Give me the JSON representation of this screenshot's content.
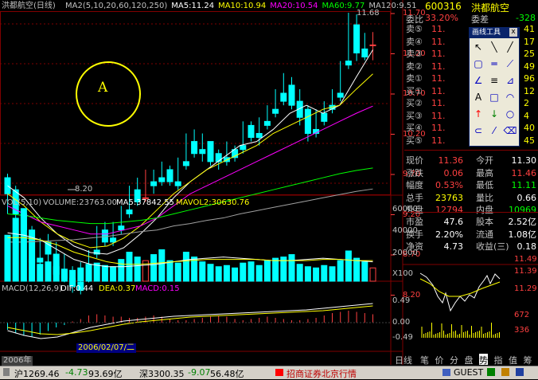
{
  "header": {
    "name": "洪都航空(日线)",
    "ma_items": [
      {
        "text": "MA2(5,10,20,60,120,250)",
        "color": "#c0c0c0"
      },
      {
        "text": "MA5:11.24",
        "color": "#ffffff"
      },
      {
        "text": "MA10:10.94",
        "color": "#ffff00"
      },
      {
        "text": "MA20:10.54",
        "color": "#ff00ff"
      },
      {
        "text": "MA60:9.77",
        "color": "#00ff00"
      },
      {
        "text": "MA120:9.51",
        "color": "#c0c0c0"
      }
    ]
  },
  "price_axis": [
    "11.70",
    "11.20",
    "10.70",
    "10.20",
    "9.70",
    "9.20",
    "8.70",
    "8.20"
  ],
  "price_marks": {
    "high": "11.68",
    "low": "8.20"
  },
  "annotation": "A",
  "vol": {
    "title": "VOL(5,10)",
    "volume": "VOLUME:23763.00",
    "ma5": "MA5:37842.55",
    "mavol2": "MAVOL2:30630.76",
    "axis": [
      "60000",
      "40000",
      "20000",
      "X100"
    ]
  },
  "macd": {
    "title": "MACD(12,26,9)",
    "dif": "DIF:0.44",
    "dea": "DEA:0.37",
    "macd": "MACD:0.15",
    "axis": [
      "0.49",
      "0.00",
      "-0.49"
    ],
    "date": "2006/02/07/二"
  },
  "bottom_left_year": "2006年",
  "quote": {
    "code": "600316",
    "name": "洪都航空",
    "webi_label": "委比",
    "webi": "33.20%",
    "weicha_label": "委差",
    "weicha": "-328",
    "asks": [
      {
        "l": "卖⑤",
        "p": "11.",
        "v": "41"
      },
      {
        "l": "卖④",
        "p": "11.",
        "v": "17"
      },
      {
        "l": "卖③",
        "p": "11.",
        "v": "25"
      },
      {
        "l": "卖②",
        "p": "11.",
        "v": "49"
      },
      {
        "l": "卖①",
        "p": "11.",
        "v": "96"
      }
    ],
    "bids": [
      {
        "l": "买①",
        "p": "11.",
        "v": "12"
      },
      {
        "l": "买②",
        "p": "11.",
        "v": "2"
      },
      {
        "l": "买③",
        "p": "11.",
        "v": "4"
      },
      {
        "l": "买④",
        "p": "11.",
        "v": "40"
      },
      {
        "l": "买⑤",
        "p": "11.",
        "v": "45"
      }
    ],
    "rows": [
      [
        {
          "t": "现价",
          "c": "#c0c0c0"
        },
        {
          "t": "11.36",
          "c": "#ff4040"
        },
        {
          "t": "今开",
          "c": "#c0c0c0"
        },
        {
          "t": "11.30",
          "c": "#ffffff"
        }
      ],
      [
        {
          "t": "涨跌",
          "c": "#c0c0c0"
        },
        {
          "t": "0.06",
          "c": "#ff4040"
        },
        {
          "t": "最高",
          "c": "#c0c0c0"
        },
        {
          "t": "11.46",
          "c": "#ff4040"
        }
      ],
      [
        {
          "t": "幅度",
          "c": "#c0c0c0"
        },
        {
          "t": "0.53%",
          "c": "#ff4040"
        },
        {
          "t": "最低",
          "c": "#c0c0c0"
        },
        {
          "t": "11.11",
          "c": "#00ff00"
        }
      ],
      [
        {
          "t": "总手",
          "c": "#c0c0c0"
        },
        {
          "t": "23763",
          "c": "#ffff00"
        },
        {
          "t": "量比",
          "c": "#c0c0c0"
        },
        {
          "t": "0.66",
          "c": "#ffffff"
        }
      ],
      [
        {
          "t": "外盘",
          "c": "#c0c0c0"
        },
        {
          "t": "12794",
          "c": "#ff4040"
        },
        {
          "t": "内盘",
          "c": "#c0c0c0"
        },
        {
          "t": "10969",
          "c": "#00ff00"
        }
      ],
      [
        {
          "t": "市盈",
          "c": "#c0c0c0"
        },
        {
          "t": "47.6",
          "c": "#ffffff"
        },
        {
          "t": "股本",
          "c": "#c0c0c0"
        },
        {
          "t": "2.52亿",
          "c": "#ffffff"
        }
      ],
      [
        {
          "t": "换手",
          "c": "#c0c0c0"
        },
        {
          "t": "2.20%",
          "c": "#ffffff"
        },
        {
          "t": "流通",
          "c": "#c0c0c0"
        },
        {
          "t": "1.08亿",
          "c": "#ffffff"
        }
      ],
      [
        {
          "t": "净资",
          "c": "#c0c0c0"
        },
        {
          "t": "4.73",
          "c": "#ffffff"
        },
        {
          "t": "收益(三)",
          "c": "#c0c0c0"
        },
        {
          "t": "0.18",
          "c": "#ffffff"
        }
      ]
    ],
    "mini_axis": [
      "11.49",
      "11.39",
      "11.29",
      "672",
      "336"
    ]
  },
  "toolbox": {
    "title": "画线工具",
    "close": "x"
  },
  "tabs": [
    "日线",
    "笔",
    "价",
    "分",
    "盘",
    "势",
    "指",
    "值",
    "筹"
  ],
  "statusbar": {
    "sh_label": "沪1269.46",
    "sh_change": "-4.73",
    "sh_amount": "93.69亿",
    "sz_label": "深3300.35",
    "sz_change": "-9.07",
    "sz_amount": "56.48亿",
    "broker": "招商证券北京行情",
    "user": "GUEST"
  },
  "colors": {
    "up": "#ff4040",
    "down": "#00ffff",
    "ma5": "#ffffff",
    "ma10": "#ffff00",
    "ma20": "#ff00ff",
    "ma60": "#00ff00",
    "ma120": "#a0a0a0",
    "grid": "#800000"
  }
}
